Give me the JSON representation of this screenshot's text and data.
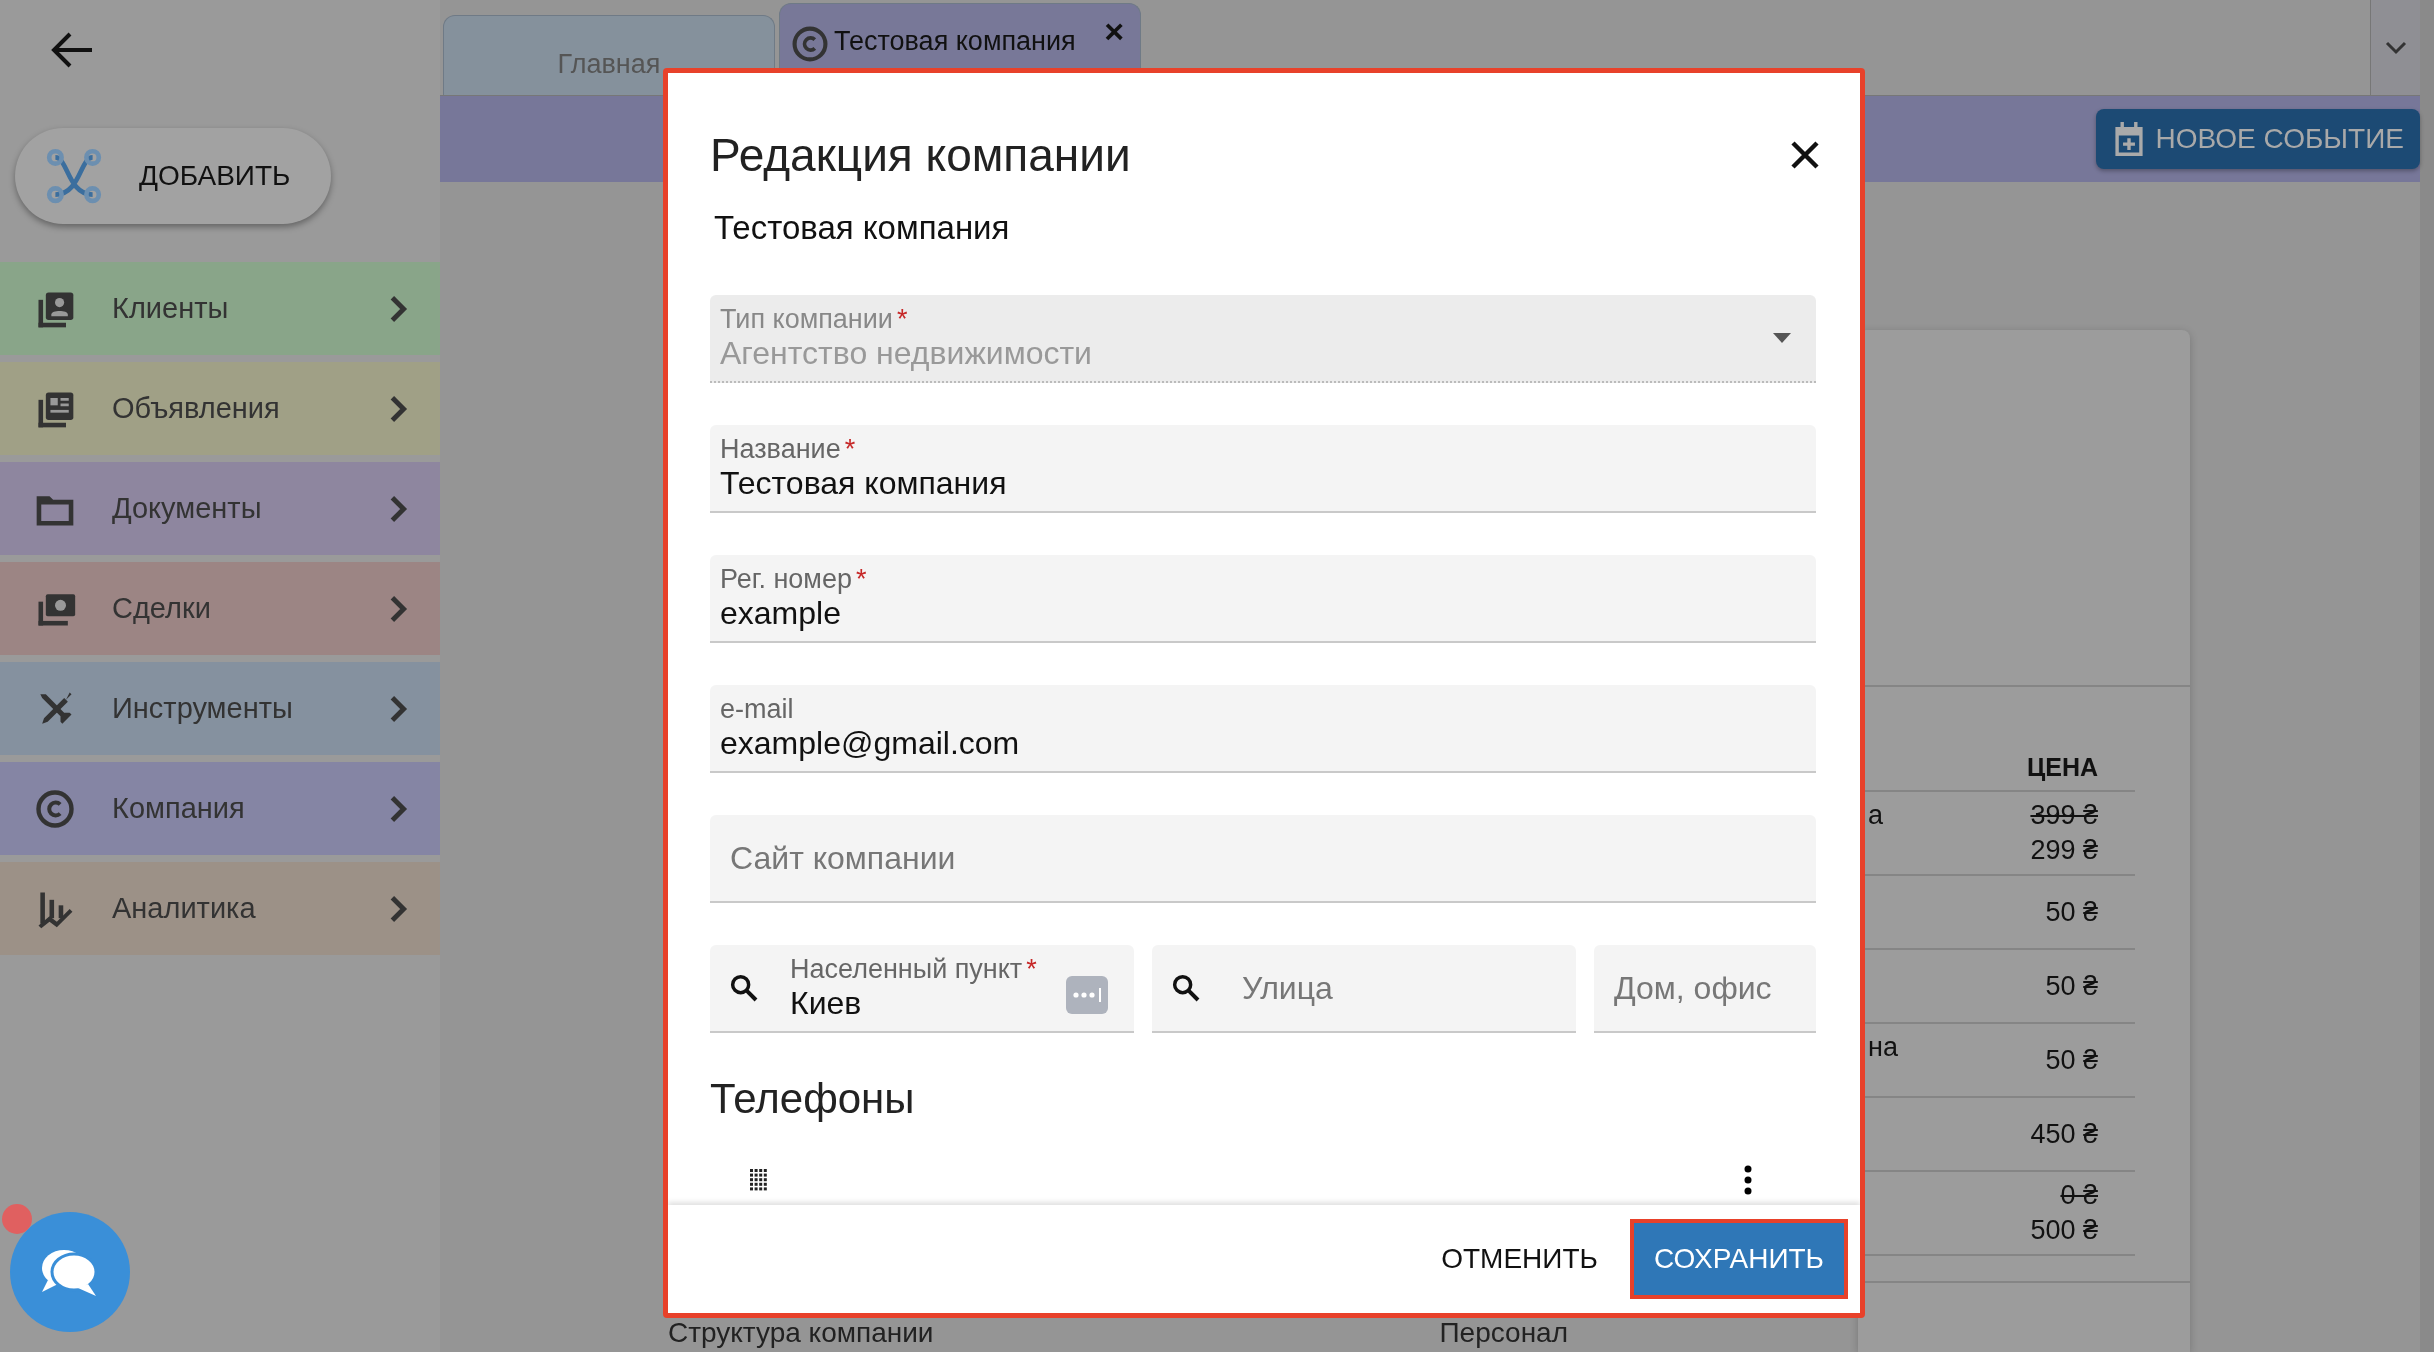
{
  "add_button": {
    "label": "ДОБАВИТЬ"
  },
  "menu": [
    {
      "label": "Клиенты",
      "color": "#89a589"
    },
    {
      "label": "Объявления",
      "color": "#a0a086"
    },
    {
      "label": "Документы",
      "color": "#8e869f"
    },
    {
      "label": "Сделки",
      "color": "#9c8584"
    },
    {
      "label": "Инструменты",
      "color": "#85919f"
    },
    {
      "label": "Компания",
      "color": "#8585a4"
    },
    {
      "label": "Аналитика",
      "color": "#9c9187"
    }
  ],
  "tabs": [
    {
      "label": "Главная",
      "selected": false
    },
    {
      "label": "Тестовая компания",
      "selected": true,
      "close": "×"
    }
  ],
  "new_event_button": {
    "label": "НОВОЕ СОБЫТИЕ"
  },
  "price_table": {
    "header": "ЦЕНА",
    "rows": [
      {
        "fragment": "а",
        "old_price": "399 ₴",
        "price": "299 ₴"
      },
      {
        "price": "50 ₴"
      },
      {
        "price": "50 ₴"
      },
      {
        "fragment": "на",
        "price": "50 ₴"
      },
      {
        "price": "450 ₴"
      },
      {
        "old_price": "0 ₴",
        "price": "500 ₴"
      }
    ]
  },
  "background_sections": [
    "Структура компании",
    "Персонал"
  ],
  "dialog": {
    "title": "Редакция компании",
    "subtitle": "Тестовая компания",
    "fields": [
      {
        "kind": "select",
        "label": "Тип компании",
        "mark": "*",
        "value": "Агентство недвижимости",
        "disabled": true
      },
      {
        "kind": "text",
        "label": "Название",
        "mark": "*",
        "value": "Тестовая компания",
        "disabled": false
      },
      {
        "kind": "text",
        "label": "Рег. номер",
        "mark": "*",
        "value": "example",
        "disabled": false
      },
      {
        "kind": "text",
        "label": "e-mail",
        "value": "example@gmail.com",
        "disabled": false
      },
      {
        "kind": "text",
        "placeholder": "Сайт компании",
        "disabled": false
      }
    ],
    "address_fields": [
      {
        "kind": "search",
        "label": "Населенный пункт",
        "mark": "*",
        "value": "Киев",
        "autofill": true
      },
      {
        "kind": "search",
        "placeholder": "Улица",
        "autofill": false
      },
      {
        "kind": "plain",
        "placeholder": "Дом, офис",
        "autofill": false
      }
    ],
    "phones_title": "Телефоны",
    "cancel_button": "ОТМЕНИТЬ",
    "save_button": "СОХРАНИТЬ"
  }
}
